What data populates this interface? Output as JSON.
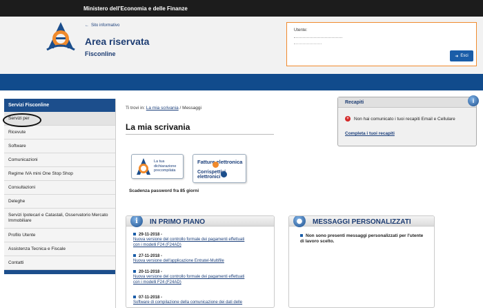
{
  "topbar": {
    "ministry": "Ministero dell'Economia e delle Finanze"
  },
  "header": {
    "site_link": "Sito informativo",
    "title": "Area riservata",
    "subtitle": "Fisconline",
    "user_label": "Utente:",
    "logout_label": "Esci"
  },
  "sidebar": {
    "heading": "Servizi Fisconline",
    "items": [
      "Servizi per",
      "Ricevute",
      "Software",
      "Comunicazioni",
      "Regime IVA mini One Stop Shop",
      "Consultazioni",
      "Deleghe",
      "Servizi Ipotecari e Catastali, Osservatorio Mercato Immobiliare",
      "Profilo Utente",
      "Assistenza Tecnica e Fiscale",
      "Contatti"
    ]
  },
  "breadcrumb": {
    "prefix": "Ti trovi in:",
    "link": "La mia scrivania",
    "sep": "/",
    "current": "Messaggi"
  },
  "main": {
    "title": "La mia scrivania",
    "tile_dichiarazione": {
      "line1": "La tua",
      "line2": "dichiarazione",
      "line3": "precompilata"
    },
    "tile_fatture": {
      "line1": "Fatture elettronica",
      "line2": "Corrispettivi elettronici"
    },
    "password_notice": "Scadenza password fra 85 giorni"
  },
  "recapiti": {
    "title": "Recapiti",
    "warning": "Non hai comunicato i tuoi recapiti Email e Cellulare",
    "link": "Completa i tuoi recapiti"
  },
  "primo_piano": {
    "title": "IN PRIMO PIANO",
    "news": [
      {
        "date": "29-11-2018 -",
        "text1": "Nuova versione del controllo formale dei pagamenti effettuati",
        "text2": "con i modelli F24 (F24AD)"
      },
      {
        "date": "27-11-2018 -",
        "text1": "Nuova versione dell'applicazione Entratel-Multifile",
        "text2": ""
      },
      {
        "date": "20-11-2018 -",
        "text1": "Nuova versione del controllo formale dei pagamenti effettuati",
        "text2": "con i modelli F24 (F24AD)"
      },
      {
        "date": "07-11-2018 -",
        "text1": "Software di compilazione della comunicazione dei dati delle",
        "text2": ""
      }
    ]
  },
  "messaggi": {
    "title": "MESSAGGI PERSONALIZZATI",
    "text": "Non sono presenti messaggi personalizzati per l'utente di lavoro scelto."
  }
}
